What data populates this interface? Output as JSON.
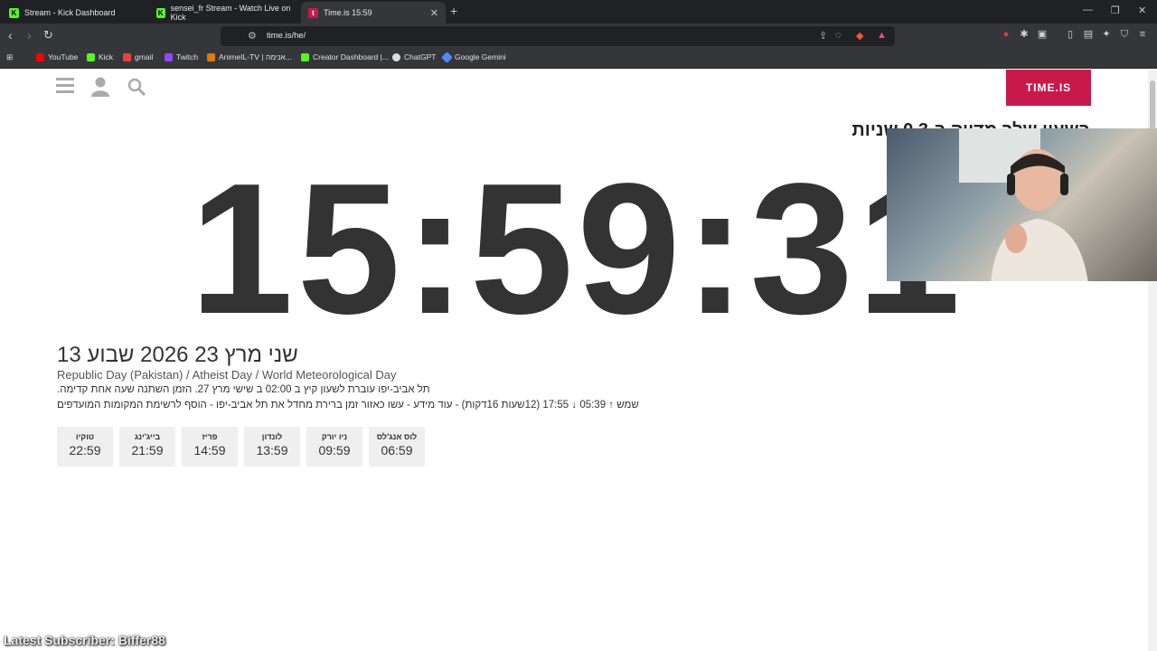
{
  "browser": {
    "tabs": [
      {
        "title": "Stream - Kick Dashboard",
        "icon": "kick-icon",
        "color": "#53fc18"
      },
      {
        "title": "sensei_fr Stream - Watch Live on Kick",
        "icon": "kick-icon",
        "color": "#53fc18"
      },
      {
        "title": "Time.is 15:59",
        "icon": "timeis-icon",
        "color": "#c8194a"
      }
    ],
    "url": "time.is/he/",
    "bookmarks": [
      {
        "label": "YouTube",
        "icon": "youtube-icon",
        "color": "#ff0000"
      },
      {
        "label": "Kick",
        "icon": "kick-icon",
        "color": "#53fc18"
      },
      {
        "label": "gmail",
        "icon": "gmail-icon",
        "color": "#ea4335"
      },
      {
        "label": "Twitch",
        "icon": "twitch-icon",
        "color": "#9146ff"
      },
      {
        "label": "AnimeIL-TV | אנימה...",
        "icon": "animeil-icon",
        "color": "#e07b00"
      },
      {
        "label": "Creator Dashboard |...",
        "icon": "kick-icon",
        "color": "#53fc18"
      },
      {
        "label": "ChatGPT",
        "icon": "chatgpt-icon",
        "color": "#dcdcdc"
      },
      {
        "label": "Google Gemini",
        "icon": "gemini-icon",
        "color": "#4f8cff"
      }
    ]
  },
  "page": {
    "brand": "TIME.IS",
    "brand_color": "#c8194a",
    "heading": "בשעון שלך מדויק ב-0.3 שניות",
    "clock": "15:59:31",
    "date": "שני מרץ 23 2026 שבוע 13",
    "holidays": "Republic Day (Pakistan) / Atheist Day / World Meteorological Day",
    "dst_note": "תל אביב-יפו עוברת לשעון קיץ ב 02:00 ב שישי מרץ 27. הזמן השתנה שעה אחת קדימה.",
    "sun_note": "שמש ↑ 05:39 ↓ 17:55 (12שעות 16דקות) - עוד מידע - עשו כאזור זמן ברירת מחדל את תל אביב-יפו - הוסף לרשימת המקומות המועדפים",
    "cities": [
      {
        "name": "טוקיו",
        "time": "22:59"
      },
      {
        "name": "בייג'ינג",
        "time": "21:59"
      },
      {
        "name": "פריז",
        "time": "14:59"
      },
      {
        "name": "לונדון",
        "time": "13:59"
      },
      {
        "name": "ניו יורק",
        "time": "09:59"
      },
      {
        "name": "לוס אנג'לס",
        "time": "06:59"
      }
    ]
  },
  "stream_overlay": {
    "latest_subscriber": "Latest Subscriber: Biffer88"
  }
}
